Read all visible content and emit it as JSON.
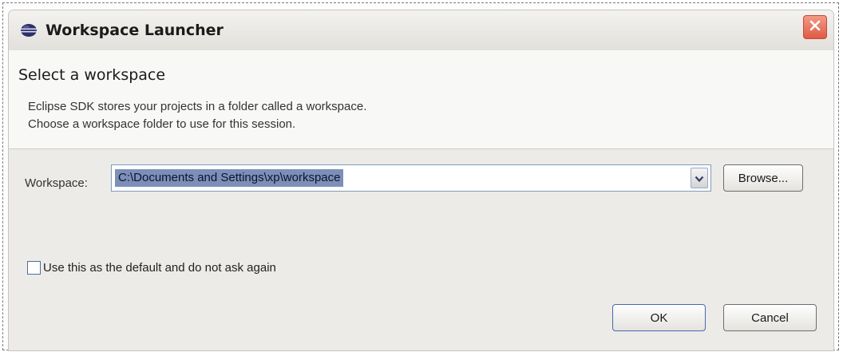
{
  "window": {
    "title": "Workspace Launcher",
    "icons": {
      "app": "eclipse-icon",
      "close": "close-icon"
    }
  },
  "header": {
    "title": "Select a workspace",
    "description_lines": [
      "Eclipse SDK stores your projects in a folder called a workspace.",
      "Choose a workspace folder to use for this session."
    ]
  },
  "workspace": {
    "label": "Workspace:",
    "value": "C:\\Documents and Settings\\xp\\workspace",
    "dropdown_icon": "chevron-down-icon",
    "browse_label": "Browse..."
  },
  "default_option": {
    "label": "Use this as the default and do not ask again",
    "checked": false
  },
  "buttons": {
    "ok": "OK",
    "cancel": "Cancel"
  },
  "colors": {
    "selection": "#7c8fb8",
    "close_button": "#e05a44"
  }
}
